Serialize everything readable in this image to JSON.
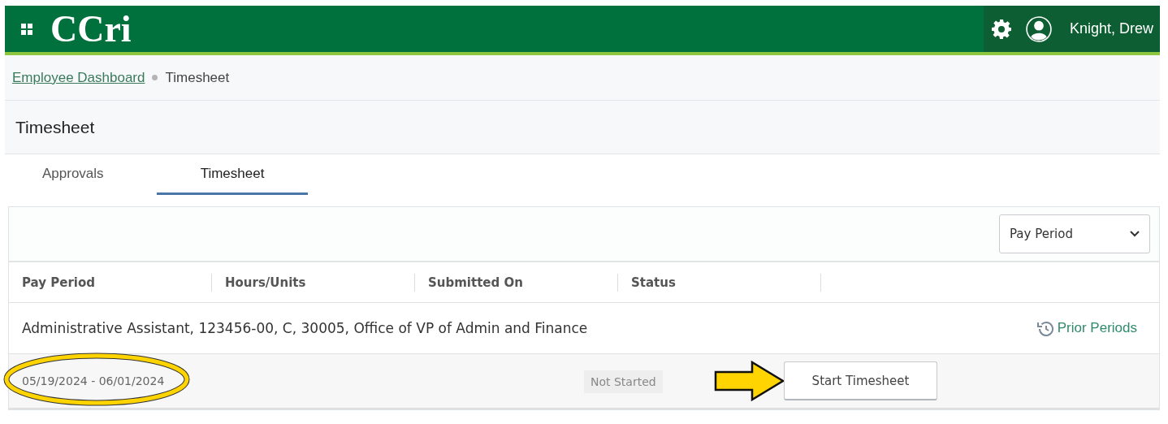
{
  "header": {
    "logo": "CCri",
    "user_name": "Knight, Drew"
  },
  "breadcrumb": [
    {
      "label": "Employee Dashboard",
      "link": true
    },
    {
      "label": "Timesheet",
      "link": false
    }
  ],
  "page_title": "Timesheet",
  "tabs": [
    {
      "label": "Approvals",
      "selected": false
    },
    {
      "label": "Timesheet",
      "selected": true
    }
  ],
  "filter": {
    "value": "Pay Period"
  },
  "table": {
    "columns": [
      "Pay Period",
      "Hours/Units",
      "Submitted On",
      "Status"
    ],
    "job": "Administrative Assistant, 123456-00, C, 30005, Office of VP of Admin and Finance",
    "prior_link": "Prior Periods",
    "rows": [
      {
        "pay_period": "05/19/2024 - 06/01/2024",
        "status": "Not Started",
        "action": "Start Timesheet"
      }
    ]
  }
}
